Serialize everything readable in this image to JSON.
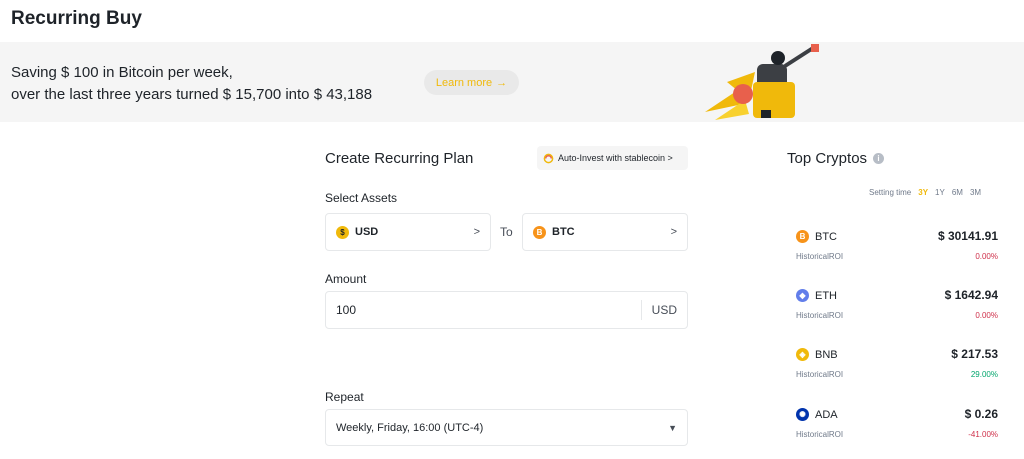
{
  "page": {
    "title": "Recurring Buy"
  },
  "banner": {
    "line1": "Saving $ 100 in Bitcoin per week,",
    "line2": "over the last three years turned $ 15,700 into $ 43,188",
    "learn_more": "Learn more",
    "learn_more_arrow": "→"
  },
  "plan": {
    "title": "Create Recurring Plan",
    "auto_invest": "Auto-Invest with stablecoin >",
    "select_assets_label": "Select Assets",
    "from_asset": "USD",
    "from_symbol": "$",
    "to_label": "To",
    "to_asset": "BTC",
    "to_symbol": "B",
    "chevron": ">",
    "amount_label": "Amount",
    "amount_value": "100",
    "amount_unit": "USD",
    "repeat_label": "Repeat",
    "repeat_value": "Weekly, Friday, 16:00 (UTC-4)",
    "repeat_caret": "▼"
  },
  "top_cryptos": {
    "title": "Top Cryptos",
    "info_glyph": "i",
    "setting_time_label": "Setting time",
    "time_options": [
      "3Y",
      "1Y",
      "6M",
      "3M"
    ],
    "active_time": "3Y",
    "roi_label": "HistoricalROI",
    "items": [
      {
        "symbol": "BTC",
        "price": "$ 30141.91",
        "roi": "0.00%",
        "roi_color": "#cf304a",
        "coin_color": "#f7931a",
        "glyph": "B"
      },
      {
        "symbol": "ETH",
        "price": "$ 1642.94",
        "roi": "0.00%",
        "roi_color": "#cf304a",
        "coin_color": "#627eea",
        "glyph": "◆"
      },
      {
        "symbol": "BNB",
        "price": "$ 217.53",
        "roi": "29.00%",
        "roi_color": "#03a66d",
        "coin_color": "#f0b90b",
        "glyph": "◈"
      },
      {
        "symbol": "ADA",
        "price": "$ 0.26",
        "roi": "-41.00%",
        "roi_color": "#cf304a",
        "coin_color": "#0033ad",
        "glyph": "✺"
      }
    ]
  },
  "colors": {
    "accent": "#f0b90b",
    "usd_coin": "#f0b90b",
    "btc_coin": "#f7931a"
  }
}
